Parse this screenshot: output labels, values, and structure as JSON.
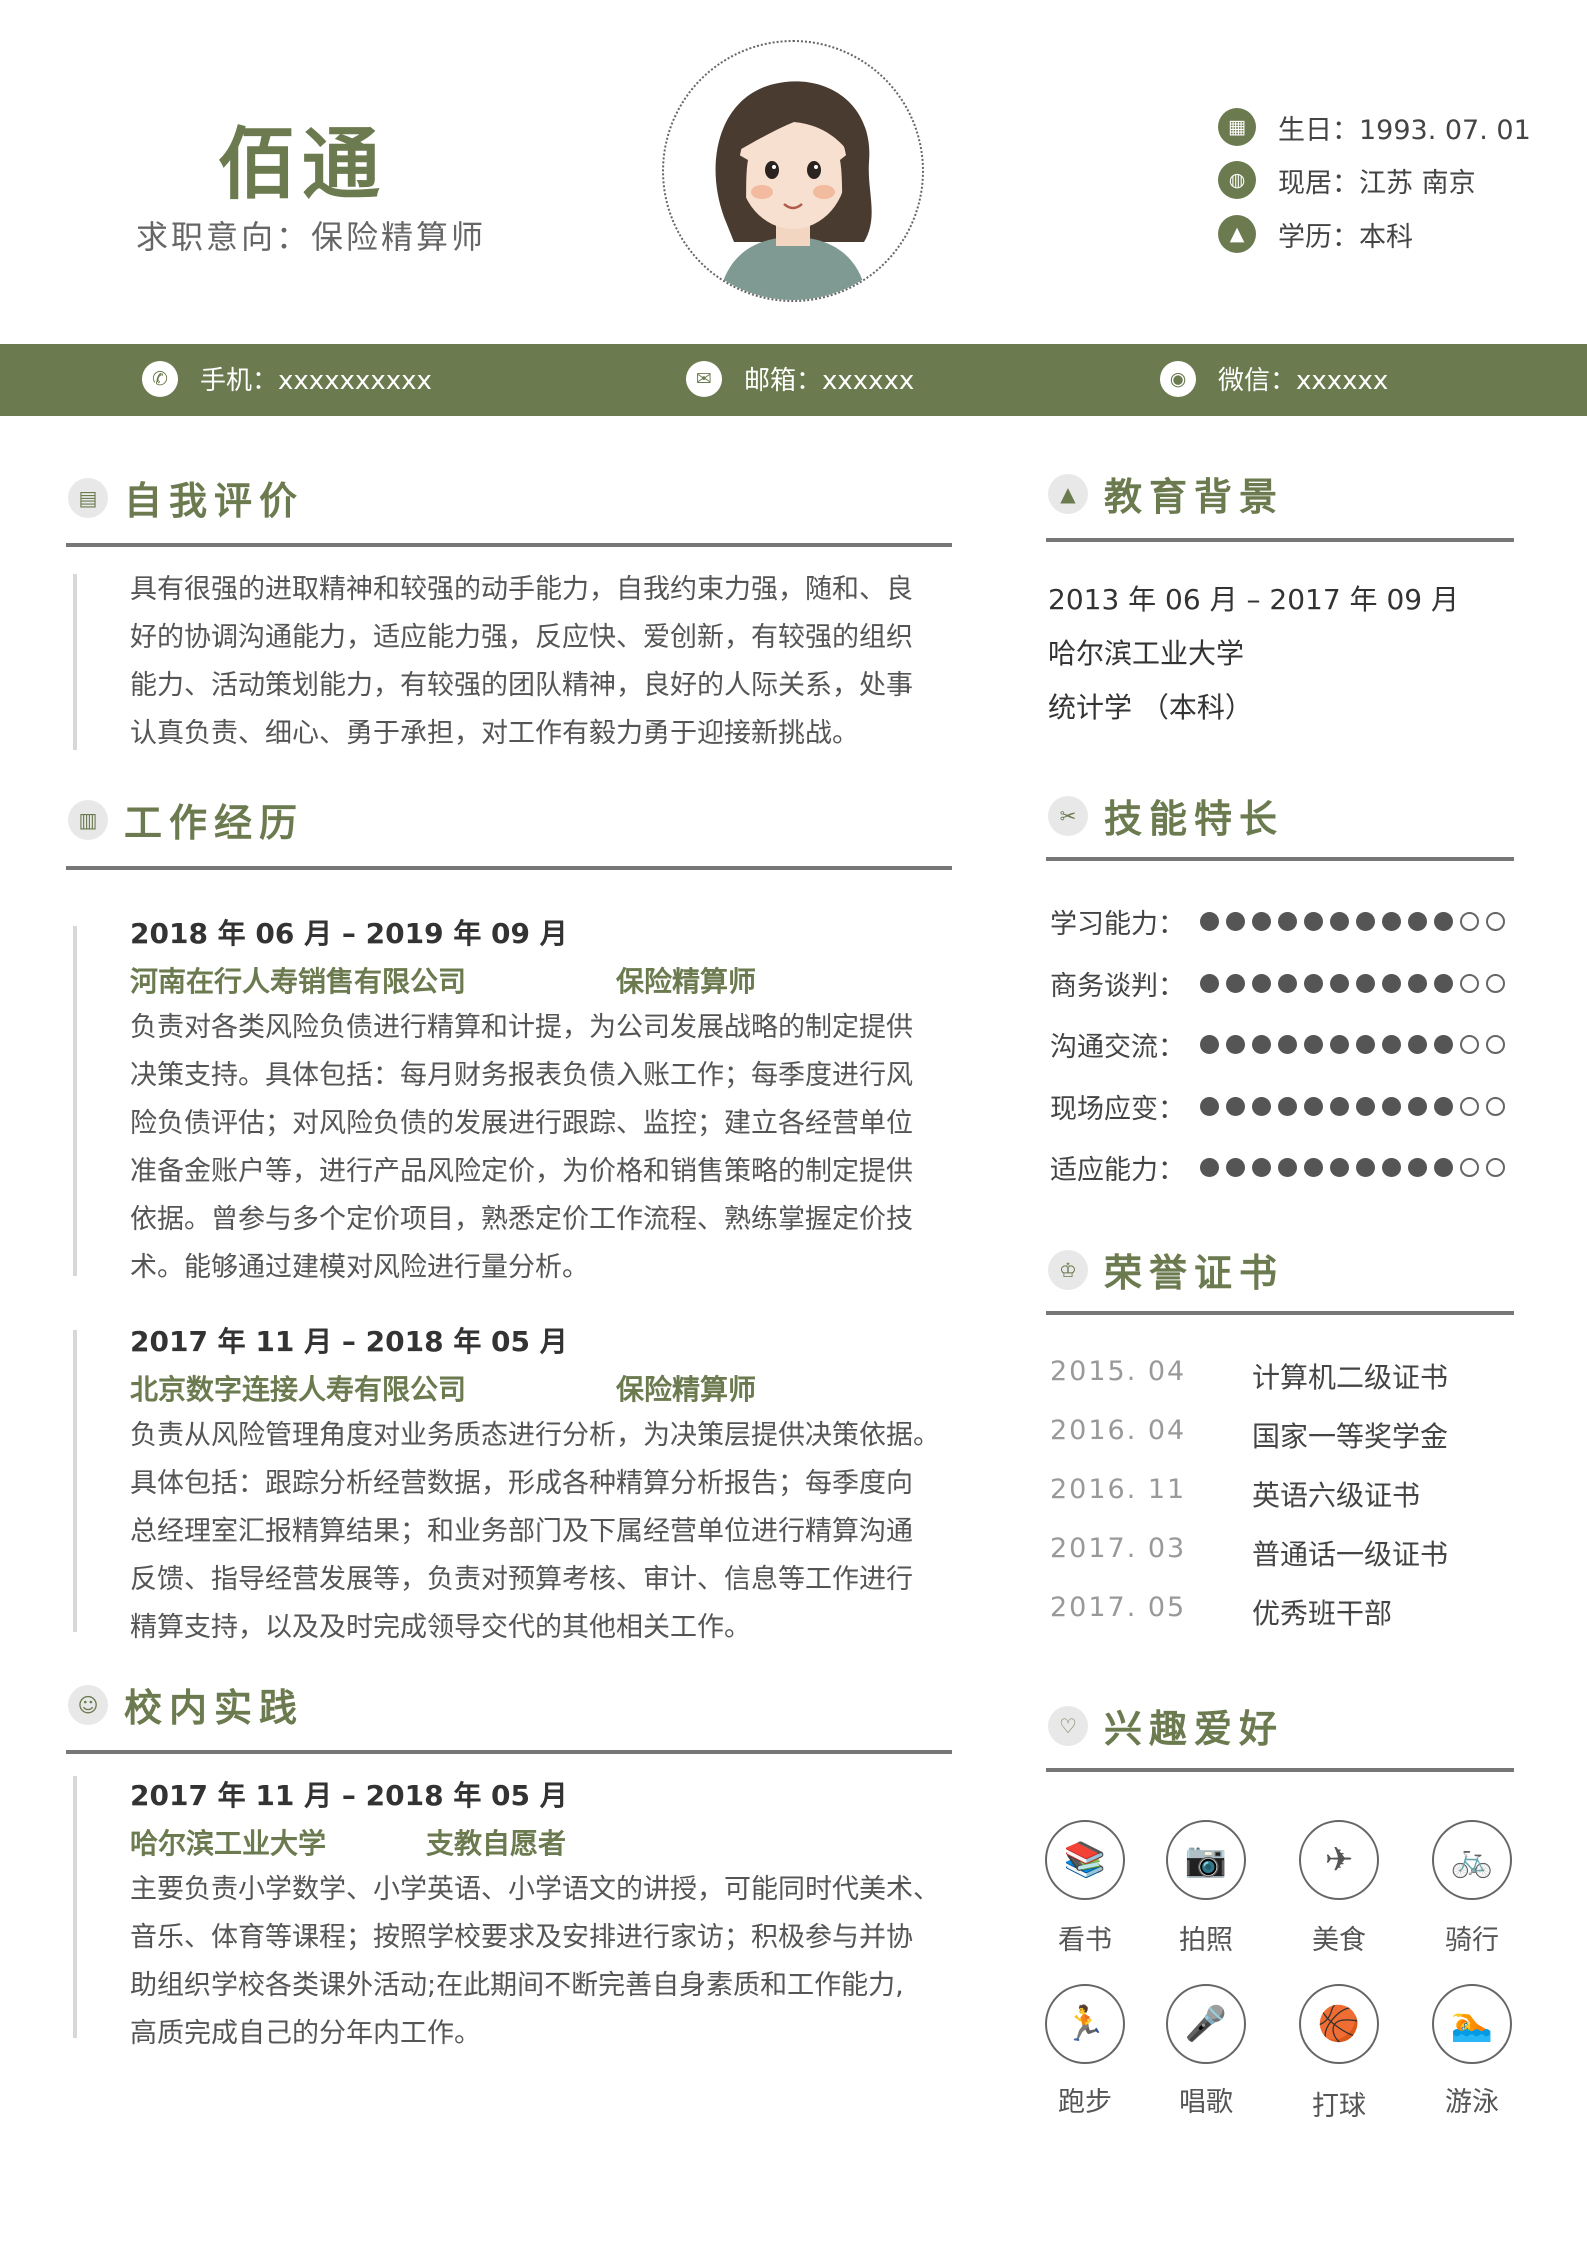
{
  "header": {
    "name": "佰通",
    "intent": "求职意向：保险精算师",
    "info": [
      {
        "icon": "calendar-icon",
        "text": "生日：1993. 07. 01"
      },
      {
        "icon": "globe-icon",
        "text": "现居：江苏  南京"
      },
      {
        "icon": "graduation-cap-icon",
        "text": "学历：本科"
      }
    ]
  },
  "contact": [
    {
      "icon": "phone-icon",
      "text": "手机：xxxxxxxxxx"
    },
    {
      "icon": "mail-icon",
      "text": "邮箱：xxxxxx"
    },
    {
      "icon": "wechat-icon",
      "text": "微信：xxxxxx"
    }
  ],
  "self_eval": {
    "title": "自我评价",
    "lines": [
      "具有很强的进取精神和较强的动手能力，自我约束力强，随和、良",
      "好的协调沟通能力，适应能力强，反应快、爱创新，有较强的组织",
      "能力、活动策划能力，有较强的团队精神，良好的人际关系，处事",
      "认真负责、细心、勇于承担，对工作有毅力勇于迎接新挑战。"
    ]
  },
  "work": {
    "title": "工作经历",
    "items": [
      {
        "date": "2018 年 06 月  –  2019 年 09 月",
        "company": "河南在行人寿销售有限公司",
        "role": "保险精算师",
        "lines": [
          "负责对各类风险负债进行精算和计提，为公司发展战略的制定提供",
          "决策支持。具体包括：每月财务报表负债入账工作；每季度进行风",
          "险负债评估；对风险负债的发展进行跟踪、监控；建立各经营单位",
          "准备金账户等，进行产品风险定价，为价格和销售策略的制定提供",
          "依据。曾参与多个定价项目，熟悉定价工作流程、熟练掌握定价技",
          "术。能够通过建模对风险进行量分析。"
        ]
      },
      {
        "date": "2017 年 11 月  –  2018 年 05 月",
        "company": "北京数字连接人寿有限公司",
        "role": "保险精算师",
        "lines": [
          "负责从风险管理角度对业务质态进行分析，为决策层提供决策依据。",
          "具体包括：跟踪分析经营数据，形成各种精算分析报告；每季度向",
          "总经理室汇报精算结果；和业务部门及下属经营单位进行精算沟通",
          "反馈、指导经营发展等，负责对预算考核、审计、信息等工作进行",
          "精算支持，以及及时完成领导交代的其他相关工作。"
        ]
      }
    ]
  },
  "campus": {
    "title": "校内实践",
    "date": "2017 年 11 月  –  2018 年 05 月",
    "org": "哈尔滨工业大学",
    "role": "支教自愿者",
    "lines": [
      "主要负责小学数学、小学英语、小学语文的讲授，可能同时代美术、",
      "音乐、体育等课程；按照学校要求及安排进行家访；积极参与并协",
      "助组织学校各类课外活动;在此期间不断完善自身素质和工作能力,",
      "高质完成自己的分年内工作。"
    ]
  },
  "education": {
    "title": "教育背景",
    "date": "2013 年 06 月  –  2017 年 09 月",
    "school": "哈尔滨工业大学",
    "major": "统计学    （本科）"
  },
  "skills": {
    "title": "技能特长",
    "max": 12,
    "items": [
      {
        "label": "学习能力：",
        "level": 10
      },
      {
        "label": "商务谈判：",
        "level": 10
      },
      {
        "label": "沟通交流：",
        "level": 10
      },
      {
        "label": "现场应变：",
        "level": 10
      },
      {
        "label": "适应能力：",
        "level": 10
      }
    ]
  },
  "honors": {
    "title": "荣誉证书",
    "items": [
      {
        "date": "2015. 04",
        "name": "计算机二级证书"
      },
      {
        "date": "2016. 04",
        "name": "国家一等奖学金"
      },
      {
        "date": "2016. 11",
        "name": "英语六级证书"
      },
      {
        "date": "2017. 03",
        "name": "普通话一级证书"
      },
      {
        "date": "2017. 05",
        "name": "优秀班干部"
      }
    ]
  },
  "hobbies": {
    "title": "兴趣爱好",
    "items": [
      {
        "icon": "books-icon",
        "glyph": "📚",
        "label": "看书"
      },
      {
        "icon": "camera-icon",
        "glyph": "📷",
        "label": "拍照"
      },
      {
        "icon": "airplane-icon",
        "glyph": "✈",
        "label": "美食"
      },
      {
        "icon": "bicycle-icon",
        "glyph": "🚲",
        "label": "骑行"
      },
      {
        "icon": "running-icon",
        "glyph": "🏃",
        "label": "跑步"
      },
      {
        "icon": "microphone-icon",
        "glyph": "🎤",
        "label": "唱歌"
      },
      {
        "icon": "basketball-icon",
        "glyph": "🏀",
        "label": "打球"
      },
      {
        "icon": "swimming-icon",
        "glyph": "🏊",
        "label": "游泳"
      }
    ]
  },
  "colors": {
    "accent": "#6b7a4f",
    "rule": "#777777"
  }
}
